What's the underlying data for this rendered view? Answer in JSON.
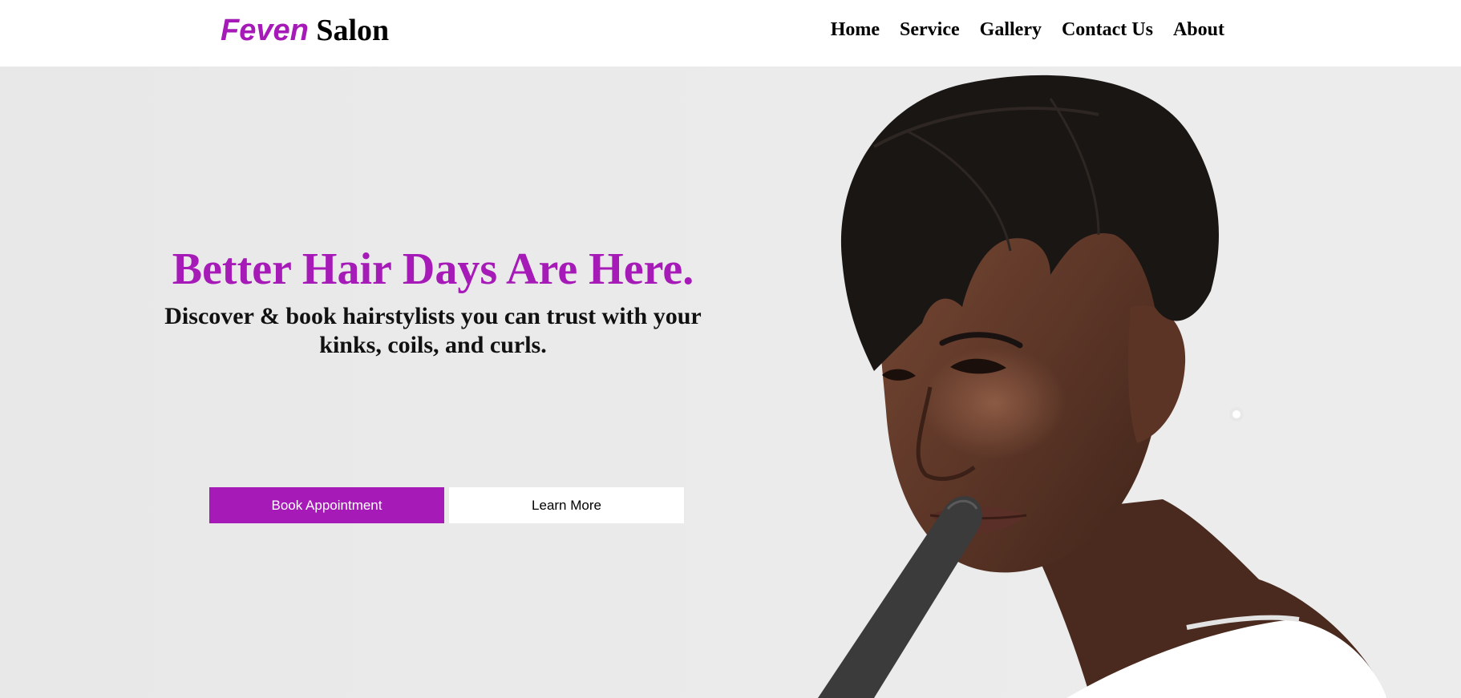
{
  "brand": {
    "name_first": "Feven",
    "name_second": "Salon",
    "accent_color": "#a61ab8"
  },
  "nav": {
    "items": [
      {
        "label": "Home"
      },
      {
        "label": "Service"
      },
      {
        "label": "Gallery"
      },
      {
        "label": "Contact Us"
      },
      {
        "label": "About"
      }
    ]
  },
  "hero": {
    "headline": "Better Hair Days Are Here.",
    "subheadline": "Discover & book hairstylists you can trust with your kinks, coils, and curls.",
    "primary_button": "Book Appointment",
    "secondary_button": "Learn More"
  }
}
